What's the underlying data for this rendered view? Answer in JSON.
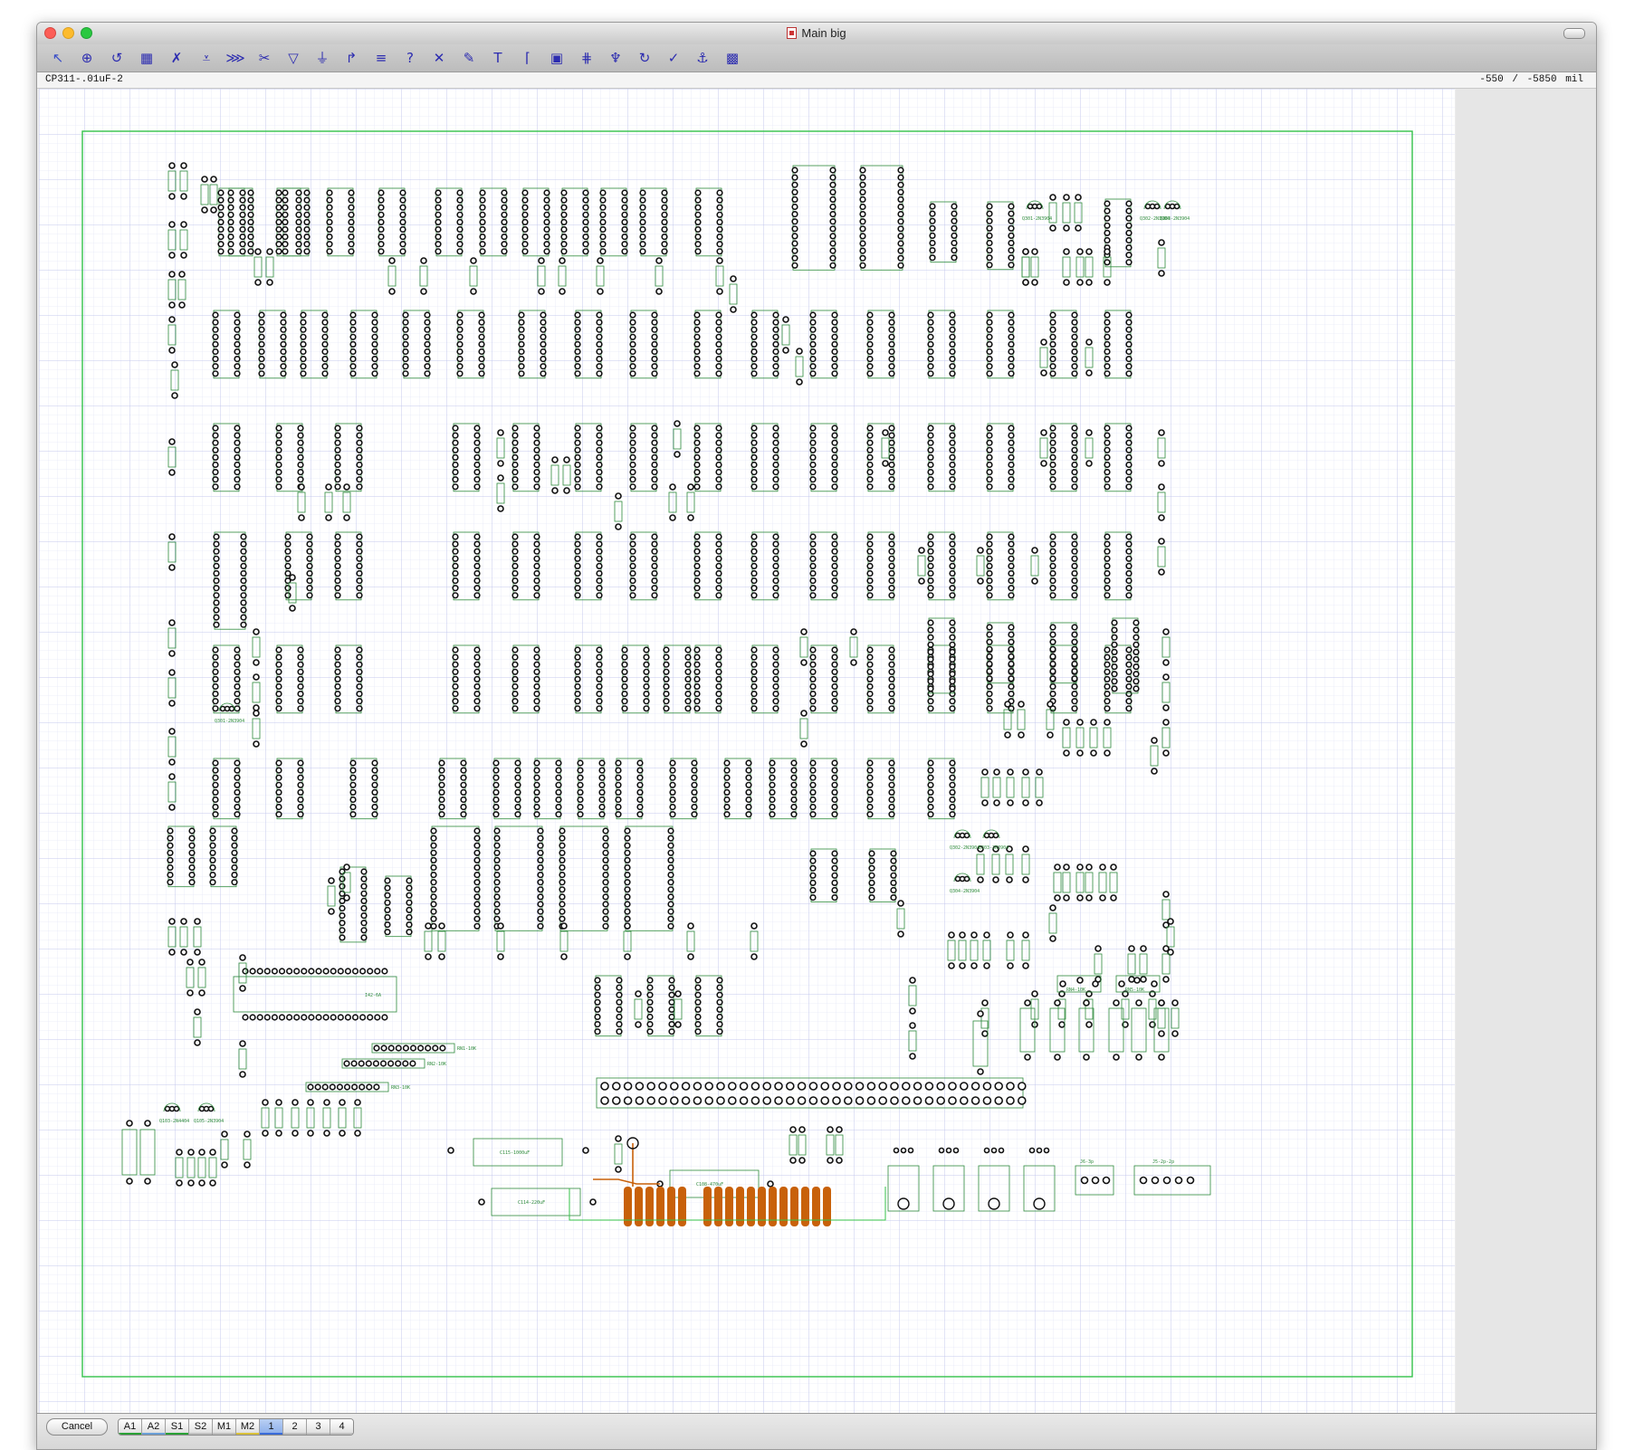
{
  "window": {
    "title": "Main big"
  },
  "toolbar": {
    "tools": [
      {
        "name": "select-tool",
        "glyph": "↖"
      },
      {
        "name": "zoom-tool",
        "glyph": "⊕"
      },
      {
        "name": "rotate-tool",
        "glyph": "↺"
      },
      {
        "name": "place-part-tool",
        "glyph": "▦"
      },
      {
        "name": "route-tool",
        "glyph": "✗"
      },
      {
        "name": "via-tool",
        "glyph": "⩡"
      },
      {
        "name": "autoroute-tool",
        "glyph": "⋙"
      },
      {
        "name": "cut-tool",
        "glyph": "✂"
      },
      {
        "name": "pad-tool",
        "glyph": "▽"
      },
      {
        "name": "ground-tool",
        "glyph": "⏚"
      },
      {
        "name": "arc-tool",
        "glyph": "↱"
      },
      {
        "name": "bus-tool",
        "glyph": "≡"
      },
      {
        "name": "info-tool",
        "glyph": "?"
      },
      {
        "name": "delete-tool",
        "glyph": "✕"
      },
      {
        "name": "pen-tool",
        "glyph": "✎"
      },
      {
        "name": "text-tool",
        "glyph": "T"
      },
      {
        "name": "corner-tool",
        "glyph": "⌈"
      },
      {
        "name": "outline-tool",
        "glyph": "▣"
      },
      {
        "name": "align-tool",
        "glyph": "⋕"
      },
      {
        "name": "probe-tool",
        "glyph": "♆"
      },
      {
        "name": "refresh-tool",
        "glyph": "↻"
      },
      {
        "name": "check-tool",
        "glyph": "✓"
      },
      {
        "name": "anchor-tool",
        "glyph": "⚓"
      },
      {
        "name": "chip-tool",
        "glyph": "▩"
      }
    ]
  },
  "status": {
    "selected_part": "CP311-.01uF-2",
    "x_coord": "-550",
    "y_coord": "-5850",
    "unit": "mil"
  },
  "bottom": {
    "cancel_label": "Cancel",
    "layers": [
      {
        "label": "A1",
        "underline": "#2aa036",
        "selected": false
      },
      {
        "label": "A2",
        "underline": "#6b9fd6",
        "selected": false
      },
      {
        "label": "S1",
        "underline": "#2aa036",
        "selected": false
      },
      {
        "label": "S2",
        "underline": "#c0c0c0",
        "selected": false
      },
      {
        "label": "M1",
        "underline": "#c0c0c0",
        "selected": false
      },
      {
        "label": "M2",
        "underline": "#d9c13a",
        "selected": false
      },
      {
        "label": "1",
        "underline": "#3a6bd9",
        "selected": true
      },
      {
        "label": "2",
        "underline": "#c0c0c0",
        "selected": false
      },
      {
        "label": "3",
        "underline": "#c0c0c0",
        "selected": false
      },
      {
        "label": "4",
        "underline": "#c0c0c0",
        "selected": false
      }
    ]
  },
  "board": {
    "silk_color": "#2e8b3c",
    "outline_color": "#34c24a",
    "pad_color": "#111111",
    "trace_color": "#c8610a",
    "grid_color": "#c9cdf0",
    "labels": {
      "q301": "Q301-2N3904",
      "q302": "Q302-2N3904",
      "q303": "Q303-2N3904",
      "q304": "Q304-2N3904",
      "q103": "Q103-2N4404",
      "q105": "Q105-2N3904",
      "q101": "Q101-2N4404",
      "rn1": "RN1-10K",
      "rn2": "RN2-10K",
      "rn3": "RN3-10K",
      "c115": "C115-1000uF",
      "c114": "C114-220uF",
      "c108": "C108-470uF",
      "j5": "J5-2p-2p",
      "j6": "J6-3p",
      "i42": "I42-6A",
      "rn4": "RN4-10K",
      "rn5": "RN5-10K"
    }
  }
}
